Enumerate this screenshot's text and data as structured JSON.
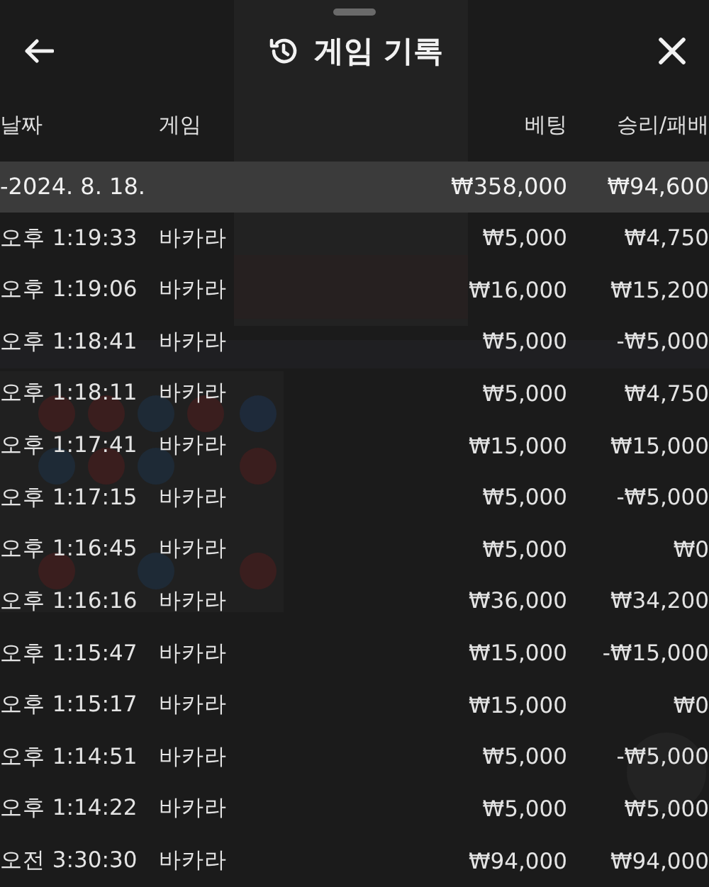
{
  "header": {
    "title": "게임 기록"
  },
  "columns": [
    "날짜",
    "게임",
    "베팅",
    "승리/패배"
  ],
  "summary": {
    "date": "-2024. 8. 18.",
    "bet": "₩358,000",
    "result": "₩94,600"
  },
  "rows": [
    {
      "time": "오후 1:19:33",
      "game": "바카라",
      "bet": "₩5,000",
      "result": "₩4,750"
    },
    {
      "time": "오후 1:19:06",
      "game": "바카라",
      "bet": "₩16,000",
      "result": "₩15,200"
    },
    {
      "time": "오후 1:18:41",
      "game": "바카라",
      "bet": "₩5,000",
      "result": "-₩5,000"
    },
    {
      "time": "오후 1:18:11",
      "game": "바카라",
      "bet": "₩5,000",
      "result": "₩4,750"
    },
    {
      "time": "오후 1:17:41",
      "game": "바카라",
      "bet": "₩15,000",
      "result": "₩15,000"
    },
    {
      "time": "오후 1:17:15",
      "game": "바카라",
      "bet": "₩5,000",
      "result": "-₩5,000"
    },
    {
      "time": "오후 1:16:45",
      "game": "바카라",
      "bet": "₩5,000",
      "result": "₩0"
    },
    {
      "time": "오후 1:16:16",
      "game": "바카라",
      "bet": "₩36,000",
      "result": "₩34,200"
    },
    {
      "time": "오후 1:15:47",
      "game": "바카라",
      "bet": "₩15,000",
      "result": "-₩15,000"
    },
    {
      "time": "오후 1:15:17",
      "game": "바카라",
      "bet": "₩15,000",
      "result": "₩0"
    },
    {
      "time": "오후 1:14:51",
      "game": "바카라",
      "bet": "₩5,000",
      "result": "-₩5,000"
    },
    {
      "time": "오후 1:14:22",
      "game": "바카라",
      "bet": "₩5,000",
      "result": "₩5,000"
    },
    {
      "time": "오전 3:30:30",
      "game": "바카라",
      "bet": "₩94,000",
      "result": "₩94,000"
    }
  ]
}
